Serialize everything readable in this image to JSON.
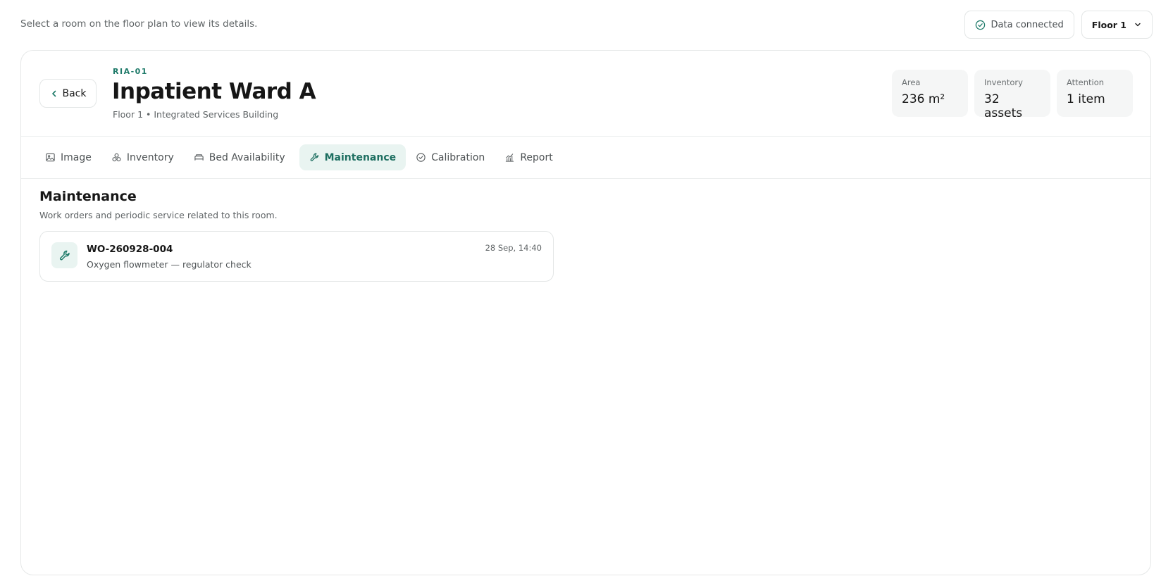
{
  "hint": "Select a room on the floor plan to view its details.",
  "top": {
    "status_label": "Data connected",
    "floor_select_value": "Floor 1"
  },
  "room": {
    "back_label": "Back",
    "code": "RIA-01",
    "name": "Inpatient Ward A",
    "location": "Floor 1 • Integrated Services Building"
  },
  "stats": [
    {
      "label": "Area",
      "value": "236 m²"
    },
    {
      "label": "Inventory",
      "value": "32 assets"
    },
    {
      "label": "Attention",
      "value": "1 item"
    }
  ],
  "tabs": [
    {
      "label": "Image",
      "icon": "image-icon"
    },
    {
      "label": "Inventory",
      "icon": "boxes-icon"
    },
    {
      "label": "Bed Availability",
      "icon": "bed-icon"
    },
    {
      "label": "Maintenance",
      "icon": "wrench-icon",
      "active": true
    },
    {
      "label": "Calibration",
      "icon": "check-circle-icon"
    },
    {
      "label": "Report",
      "icon": "chart-icon"
    }
  ],
  "section": {
    "title": "Maintenance",
    "subtitle": "Work orders and periodic service related to this room."
  },
  "work_orders": [
    {
      "id": "WO-260928-004",
      "description": "Oxygen flowmeter — regulator check",
      "time": "28 Sep, 14:40"
    }
  ],
  "colors": {
    "accent": "#1e7a69",
    "accent_bg": "#e9f4f1",
    "border": "#e3e6e6"
  }
}
